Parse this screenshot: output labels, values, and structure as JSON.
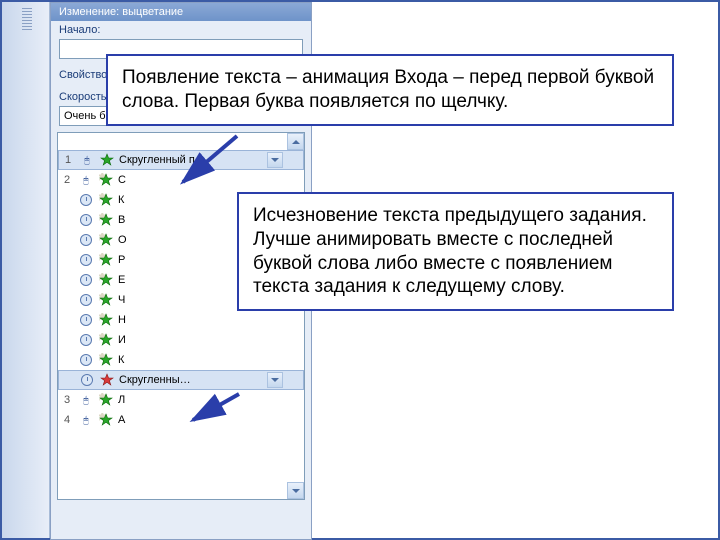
{
  "panel": {
    "header": "Изменение: выцветание",
    "start_label": "Начало:",
    "property_label": "Свойство:",
    "speed_label": "Скорость:",
    "speed_value": "Очень быстро"
  },
  "items": [
    {
      "num": "1",
      "trigger": "mouse",
      "effect": "entrance",
      "label": "Скругленный п…",
      "selected": true,
      "dropdown": true
    },
    {
      "num": "2",
      "trigger": "mouse",
      "effect": "entrance-sub",
      "label": "С"
    },
    {
      "num": "",
      "trigger": "clock",
      "effect": "entrance-sub",
      "label": "К"
    },
    {
      "num": "",
      "trigger": "clock",
      "effect": "entrance-sub",
      "label": "В"
    },
    {
      "num": "",
      "trigger": "clock",
      "effect": "entrance-sub",
      "label": "О"
    },
    {
      "num": "",
      "trigger": "clock",
      "effect": "entrance-sub",
      "label": "Р"
    },
    {
      "num": "",
      "trigger": "clock",
      "effect": "entrance-sub",
      "label": "Е"
    },
    {
      "num": "",
      "trigger": "clock",
      "effect": "entrance-sub",
      "label": "Ч"
    },
    {
      "num": "",
      "trigger": "clock",
      "effect": "entrance-sub",
      "label": "Н"
    },
    {
      "num": "",
      "trigger": "clock",
      "effect": "entrance-sub",
      "label": "И"
    },
    {
      "num": "",
      "trigger": "clock",
      "effect": "entrance-sub",
      "label": "К"
    },
    {
      "num": "",
      "trigger": "clock",
      "effect": "exit",
      "label": "Скругленны…",
      "selected": true,
      "dropdown": true
    },
    {
      "num": "3",
      "trigger": "mouse",
      "effect": "entrance-sub",
      "label": "Л"
    },
    {
      "num": "4",
      "trigger": "mouse",
      "effect": "entrance-sub",
      "label": "А"
    }
  ],
  "callouts": {
    "c1": "Появление текста – анимация Входа – перед первой буквой слова. Первая буква появляется по щелчку.",
    "c2": "Исчезновение текста предыдущего задания. Лучше анимировать вместе с последней буквой слова либо вместе с появлением текста задания к следущему слову."
  }
}
